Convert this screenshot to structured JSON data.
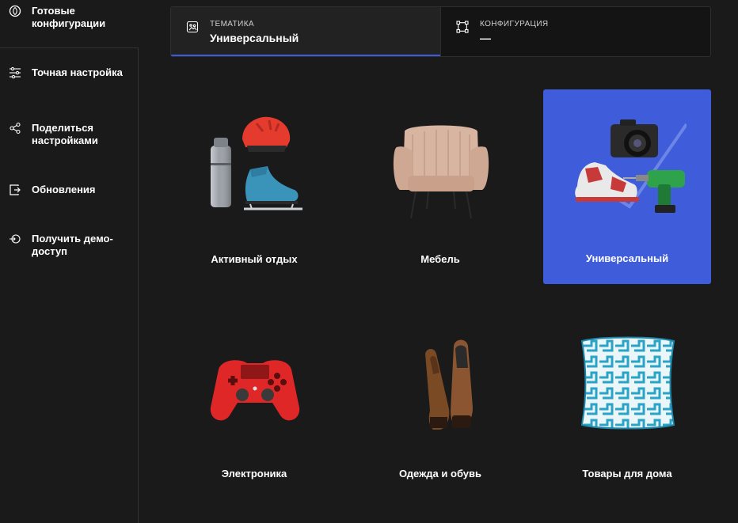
{
  "sidebar": {
    "items": [
      {
        "label": "Готовые конфигурации",
        "icon": "leaf-circle-icon"
      },
      {
        "label": "Точная настройка",
        "icon": "sliders-icon"
      },
      {
        "label": "Поделиться настройками",
        "icon": "share-icon"
      },
      {
        "label": "Обновления",
        "icon": "update-exit-icon"
      },
      {
        "label": "Получить демо-доступ",
        "icon": "demo-access-icon"
      }
    ]
  },
  "header": {
    "tabs": [
      {
        "label": "ТЕМАТИКА",
        "value": "Универсальный",
        "icon": "palette-icon",
        "active": true
      },
      {
        "label": "КОНФИГУРАЦИЯ",
        "value": "—",
        "icon": "nodes-icon",
        "active": false
      }
    ]
  },
  "themes": {
    "selected": "Универсальный",
    "items": [
      {
        "label": "Активный отдых",
        "image": "outdoor-gear-image"
      },
      {
        "label": "Мебель",
        "image": "armchair-image"
      },
      {
        "label": "Универсальный",
        "image": "universal-products-image"
      },
      {
        "label": "Электроника",
        "image": "gamepad-image"
      },
      {
        "label": "Одежда и обувь",
        "image": "shoes-image"
      },
      {
        "label": "Товары для дома",
        "image": "pillow-image"
      }
    ]
  },
  "colors": {
    "background": "#1a1a1a",
    "accent": "#3f5ddb",
    "tab_underline": "#3b5bdb"
  }
}
